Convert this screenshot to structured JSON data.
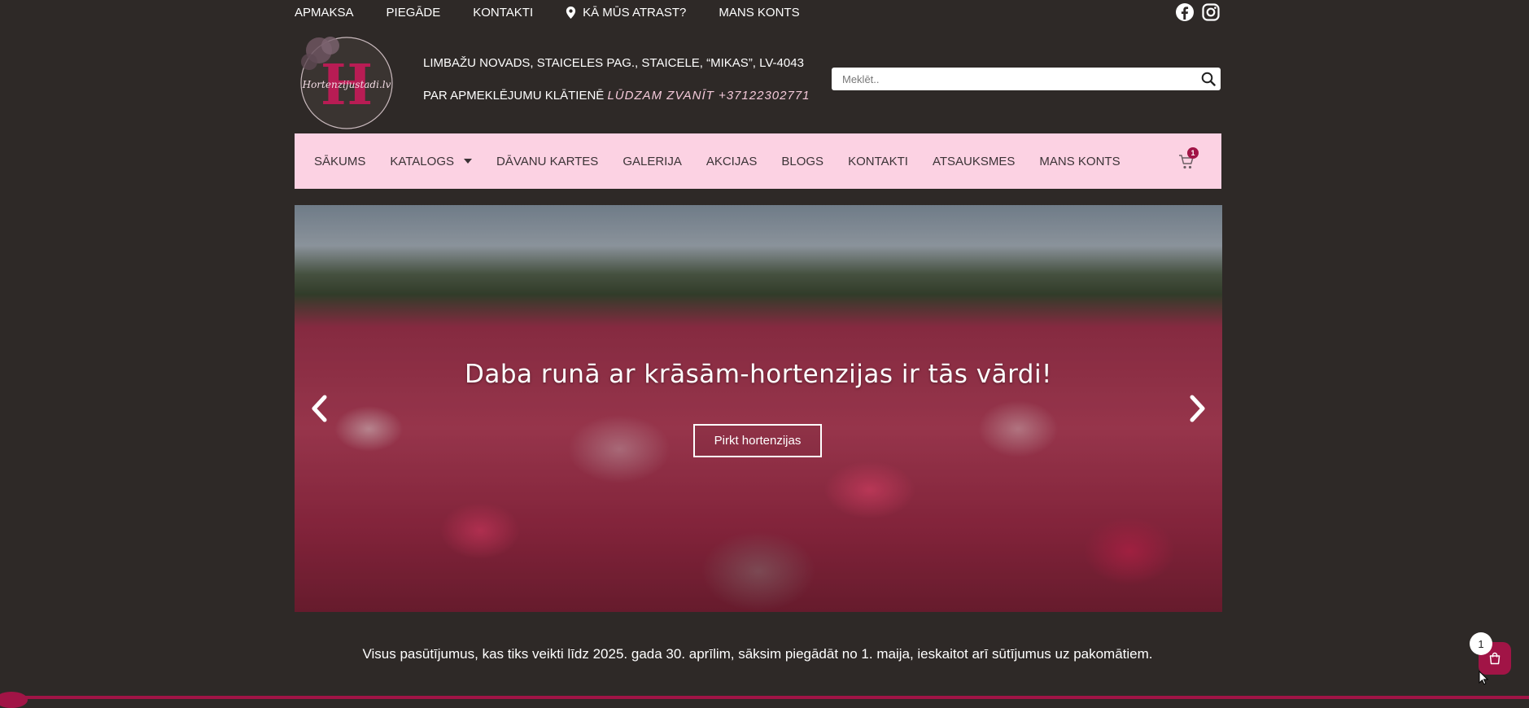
{
  "topbar": {
    "links": [
      {
        "label": "APMAKSA",
        "icon": ""
      },
      {
        "label": "PIEGĀDE",
        "icon": ""
      },
      {
        "label": "KONTAKTI",
        "icon": ""
      },
      {
        "label": "KĀ MŪS ATRAST?",
        "icon": "map-marker-icon"
      },
      {
        "label": "MANS KONTS",
        "icon": ""
      }
    ],
    "social": [
      "facebook-icon",
      "instagram-icon"
    ]
  },
  "logo": {
    "text": "Hortenzijustadi.lv",
    "letter": "H"
  },
  "header": {
    "address": "LIMBAŽU NOVADS, STAICELES PAG., STAICELE, “MIKAS”, LV-4043",
    "visit_label": "PAR APMEKLĒJUMU KLĀTIENĒ",
    "visit_phone": "LŪDZAM ZVANĪT +37122302771"
  },
  "search": {
    "placeholder": "Meklēt..",
    "value": ""
  },
  "nav": {
    "items": [
      {
        "label": "SĀKUMS"
      },
      {
        "label": "KATALOGS"
      },
      {
        "label": "DĀVANU KARTES"
      },
      {
        "label": "GALERIJA"
      },
      {
        "label": "AKCIJAS"
      },
      {
        "label": "BLOGS"
      },
      {
        "label": "KONTAKTI"
      },
      {
        "label": "ATSAUKSMES"
      },
      {
        "label": "MANS KONTS"
      }
    ],
    "cart_count": "1"
  },
  "hero": {
    "title": "Daba runā ar krāsām-hortenzijas ir tās vārdi!",
    "button": "Pirkt hortenzijas"
  },
  "notice": "Visus pasūtījumus, kas tiks veikti līdz 2025. gada 30. aprīlim, sāksim piegādāt no 1. maija, ieskaitot arī sūtījumus uz pakomātiem.",
  "floating_cart": {
    "count": "1"
  },
  "colors": {
    "background": "#2e2927",
    "nav_bg": "#fcd2e3",
    "accent": "#a11446"
  }
}
